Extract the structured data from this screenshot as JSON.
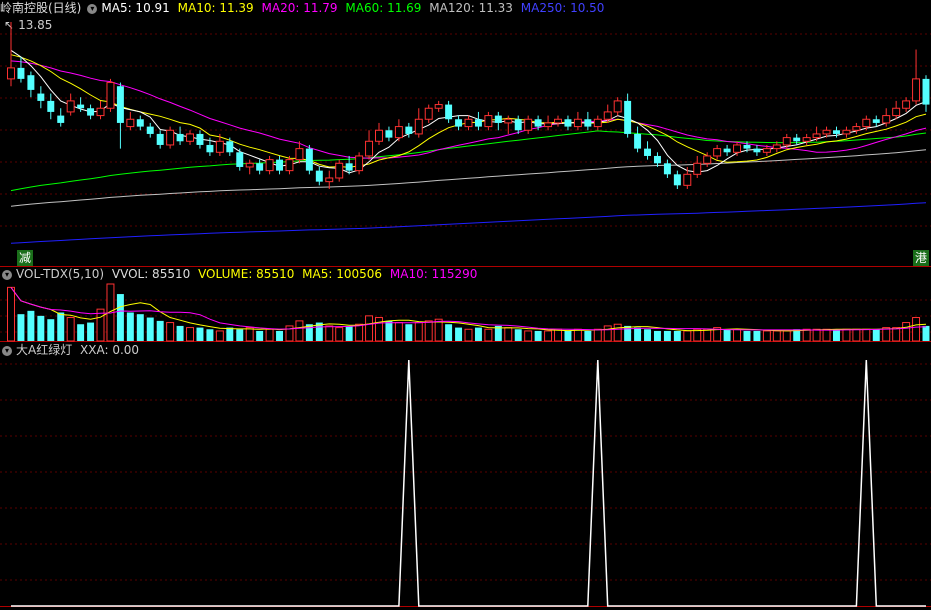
{
  "main_header": {
    "stock_name": "岭南控股(日线)",
    "ma5": "MA5: 10.91",
    "ma10": "MA10: 11.39",
    "ma20": "MA20: 11.79",
    "ma60": "MA60: 11.69",
    "ma120": "MA120: 11.33",
    "ma250": "MA250: 10.50"
  },
  "max_price_label": "13.85",
  "tags": {
    "left": "减",
    "right": "港"
  },
  "vol_header": {
    "name": "VOL-TDX(5,10)",
    "vvol": "VVOL: 85510",
    "volume": "VOLUME: 85510",
    "ma5": "MA5: 100506",
    "ma10": "MA10: 115290"
  },
  "ind_header": {
    "name": "大A红绿灯",
    "xxa": "XXA: 0.00"
  },
  "colors": {
    "up": "#ff3232",
    "down": "#54ffff",
    "ma5": "#ffffff",
    "ma10": "#ffff00",
    "ma20": "#ff00ff",
    "ma60": "#00ff00",
    "ma120": "#c0c0c0",
    "ma250": "#2020ff"
  },
  "chart_data": [
    {
      "type": "candlestick",
      "title": "岭南控股(日线)",
      "max_price": 13.85,
      "candles": [
        [
          12.3,
          12.6,
          13.85,
          12.1
        ],
        [
          12.6,
          12.3,
          12.9,
          12.2
        ],
        [
          12.4,
          12.0,
          12.5,
          11.8
        ],
        [
          11.9,
          11.7,
          12.1,
          11.5
        ],
        [
          11.7,
          11.4,
          11.9,
          11.2
        ],
        [
          11.3,
          11.1,
          11.5,
          11.0
        ],
        [
          11.4,
          11.7,
          11.9,
          11.3
        ],
        [
          11.6,
          11.5,
          11.8,
          11.4
        ],
        [
          11.5,
          11.3,
          11.6,
          11.2
        ],
        [
          11.3,
          11.5,
          11.7,
          11.2
        ],
        [
          11.5,
          12.2,
          12.3,
          11.4
        ],
        [
          12.1,
          11.1,
          12.2,
          10.4
        ],
        [
          11.0,
          11.2,
          11.4,
          10.9
        ],
        [
          11.2,
          11.0,
          11.3,
          10.9
        ],
        [
          11.0,
          10.8,
          11.1,
          10.7
        ],
        [
          10.8,
          10.5,
          10.9,
          10.4
        ],
        [
          10.5,
          10.9,
          11.0,
          10.4
        ],
        [
          10.8,
          10.6,
          11.0,
          10.5
        ],
        [
          10.6,
          10.8,
          10.9,
          10.5
        ],
        [
          10.8,
          10.5,
          10.9,
          10.4
        ],
        [
          10.5,
          10.3,
          10.7,
          10.2
        ],
        [
          10.3,
          10.6,
          10.8,
          10.2
        ],
        [
          10.6,
          10.3,
          10.7,
          10.2
        ],
        [
          10.3,
          9.9,
          10.4,
          9.8
        ],
        [
          9.9,
          10.0,
          10.1,
          9.7
        ],
        [
          10.0,
          9.8,
          10.1,
          9.7
        ],
        [
          9.8,
          10.1,
          10.2,
          9.7
        ],
        [
          10.1,
          9.8,
          10.2,
          9.7
        ],
        [
          9.8,
          10.1,
          10.2,
          9.7
        ],
        [
          10.1,
          10.4,
          10.6,
          10.0
        ],
        [
          10.4,
          9.8,
          10.5,
          9.7
        ],
        [
          9.8,
          9.5,
          9.9,
          9.4
        ],
        [
          9.5,
          9.6,
          9.8,
          9.3
        ],
        [
          9.6,
          10.0,
          10.1,
          9.5
        ],
        [
          10.0,
          9.8,
          10.2,
          9.7
        ],
        [
          9.8,
          10.2,
          10.3,
          9.7
        ],
        [
          10.2,
          10.6,
          10.9,
          10.1
        ],
        [
          10.6,
          10.9,
          11.1,
          10.5
        ],
        [
          10.9,
          10.7,
          11.0,
          10.6
        ],
        [
          10.7,
          11.0,
          11.2,
          10.6
        ],
        [
          11.0,
          10.8,
          11.1,
          10.7
        ],
        [
          10.8,
          11.2,
          11.5,
          10.7
        ],
        [
          11.2,
          11.5,
          11.6,
          11.1
        ],
        [
          11.5,
          11.6,
          11.7,
          11.4
        ],
        [
          11.6,
          11.2,
          11.7,
          11.1
        ],
        [
          11.2,
          11.0,
          11.3,
          10.9
        ],
        [
          11.0,
          11.2,
          11.3,
          10.9
        ],
        [
          11.2,
          11.0,
          11.4,
          10.9
        ],
        [
          11.0,
          11.3,
          11.4,
          10.9
        ],
        [
          11.3,
          11.1,
          11.4,
          10.9
        ],
        [
          11.1,
          11.2,
          11.3,
          10.8
        ],
        [
          11.2,
          10.9,
          11.3,
          10.8
        ],
        [
          10.9,
          11.2,
          11.3,
          10.8
        ],
        [
          11.2,
          11.0,
          11.3,
          10.9
        ],
        [
          11.0,
          11.1,
          11.3,
          10.9
        ],
        [
          11.1,
          11.2,
          11.3,
          11.0
        ],
        [
          11.2,
          11.0,
          11.3,
          10.9
        ],
        [
          11.0,
          11.2,
          11.4,
          10.9
        ],
        [
          11.2,
          11.0,
          11.4,
          10.9
        ],
        [
          11.0,
          11.2,
          11.3,
          10.9
        ],
        [
          11.2,
          11.4,
          11.6,
          11.1
        ],
        [
          11.4,
          11.7,
          11.8,
          11.3
        ],
        [
          11.7,
          10.8,
          11.9,
          10.7
        ],
        [
          10.8,
          10.4,
          11.0,
          10.3
        ],
        [
          10.4,
          10.2,
          10.6,
          10.1
        ],
        [
          10.2,
          10.0,
          10.3,
          9.9
        ],
        [
          10.0,
          9.7,
          10.1,
          9.6
        ],
        [
          9.7,
          9.4,
          9.8,
          9.3
        ],
        [
          9.4,
          9.7,
          9.9,
          9.3
        ],
        [
          9.7,
          10.0,
          10.2,
          9.6
        ],
        [
          10.0,
          10.2,
          10.3,
          9.9
        ],
        [
          10.2,
          10.4,
          10.5,
          10.1
        ],
        [
          10.4,
          10.3,
          10.5,
          10.2
        ],
        [
          10.3,
          10.5,
          10.6,
          10.2
        ],
        [
          10.5,
          10.4,
          10.6,
          10.3
        ],
        [
          10.4,
          10.3,
          10.5,
          10.2
        ],
        [
          10.3,
          10.4,
          10.5,
          10.2
        ],
        [
          10.4,
          10.5,
          10.6,
          10.3
        ],
        [
          10.5,
          10.7,
          10.8,
          10.4
        ],
        [
          10.7,
          10.6,
          10.8,
          10.5
        ],
        [
          10.6,
          10.7,
          10.8,
          10.5
        ],
        [
          10.7,
          10.8,
          11.0,
          10.6
        ],
        [
          10.8,
          10.9,
          11.0,
          10.7
        ],
        [
          10.9,
          10.8,
          11.0,
          10.7
        ],
        [
          10.8,
          10.9,
          11.0,
          10.7
        ],
        [
          10.9,
          11.0,
          11.1,
          10.8
        ],
        [
          11.0,
          11.2,
          11.3,
          10.9
        ],
        [
          11.2,
          11.1,
          11.3,
          11.0
        ],
        [
          11.1,
          11.3,
          11.5,
          11.0
        ],
        [
          11.3,
          11.5,
          11.7,
          11.2
        ],
        [
          11.5,
          11.7,
          11.8,
          11.4
        ],
        [
          11.7,
          12.3,
          13.1,
          11.6
        ],
        [
          12.3,
          11.6,
          12.4,
          11.4
        ]
      ]
    },
    {
      "type": "bar",
      "title": "VOL-TDX(5,10)",
      "volume_up": [
        1,
        0,
        0,
        0,
        0,
        0,
        1,
        0,
        0,
        1,
        1,
        0,
        0,
        0,
        0,
        0,
        1,
        0,
        1,
        0,
        0,
        1,
        0,
        0,
        1,
        0,
        1,
        0,
        1,
        1,
        0,
        0,
        1,
        1,
        0,
        1,
        1,
        1,
        0,
        1,
        0,
        1,
        1,
        1,
        0,
        0,
        1,
        0,
        1,
        0,
        1,
        0,
        1,
        0,
        1,
        1,
        0,
        1,
        0,
        1,
        1,
        1,
        0,
        0,
        0,
        0,
        0,
        0,
        1,
        1,
        1,
        1,
        0,
        1,
        0,
        0,
        1,
        1,
        1,
        0,
        1,
        1,
        1,
        0,
        1,
        1,
        1,
        0,
        1,
        1,
        1,
        1,
        0
      ],
      "volume": [
        320,
        160,
        180,
        150,
        130,
        170,
        140,
        100,
        110,
        190,
        340,
        280,
        170,
        160,
        140,
        120,
        110,
        90,
        80,
        80,
        70,
        60,
        80,
        70,
        80,
        60,
        70,
        60,
        90,
        120,
        100,
        110,
        90,
        80,
        90,
        100,
        150,
        140,
        120,
        110,
        100,
        110,
        120,
        130,
        100,
        80,
        70,
        80,
        70,
        90,
        80,
        70,
        60,
        60,
        60,
        70,
        60,
        70,
        60,
        70,
        90,
        100,
        90,
        80,
        70,
        60,
        60,
        60,
        60,
        70,
        70,
        80,
        70,
        70,
        60,
        60,
        60,
        60,
        60,
        70,
        70,
        70,
        70,
        70,
        70,
        70,
        70,
        70,
        80,
        80,
        110,
        140,
        90
      ]
    },
    {
      "type": "line",
      "title": "大A红绿灯",
      "ylim": [
        0,
        1
      ],
      "y": [
        0,
        0,
        0,
        0,
        0,
        0,
        0,
        0,
        0,
        0,
        0,
        0,
        0,
        0,
        0,
        0,
        0,
        0,
        0,
        0,
        0,
        0,
        0,
        0,
        0,
        0,
        0,
        0,
        0,
        0,
        0,
        0,
        0,
        0,
        0,
        0,
        0,
        0,
        0,
        0,
        1,
        0,
        0,
        0,
        0,
        0,
        0,
        0,
        0,
        0,
        0,
        0,
        0,
        0,
        0,
        0,
        0,
        0,
        0,
        1,
        0,
        0,
        0,
        0,
        0,
        0,
        0,
        0,
        0,
        0,
        0,
        0,
        0,
        0,
        0,
        0,
        0,
        0,
        0,
        0,
        0,
        0,
        0,
        0,
        0,
        0,
        1,
        0,
        0,
        0,
        0,
        0,
        0
      ]
    }
  ]
}
